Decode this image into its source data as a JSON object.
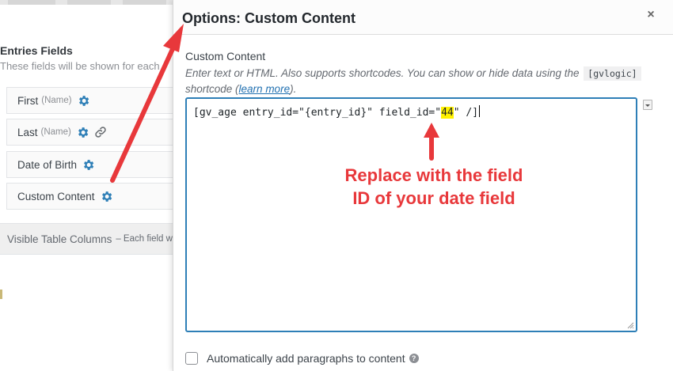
{
  "background": {
    "entries_title": "Entries Fields",
    "entries_desc": "These fields will be shown for each",
    "fields": [
      {
        "name": "First",
        "sub": "(Name)",
        "icons": [
          "gear-icon"
        ]
      },
      {
        "name": "Last",
        "sub": "(Name)",
        "icons": [
          "gear-icon",
          "link-icon"
        ]
      },
      {
        "name": "Date of Birth",
        "sub": "",
        "icons": [
          "gear-icon"
        ]
      },
      {
        "name": "Custom Content",
        "sub": "",
        "icons": [
          "gear-icon"
        ]
      }
    ],
    "visible_columns_label": "Visible Table Columns",
    "visible_columns_note": "– Each field w"
  },
  "modal": {
    "title": "Options: Custom Content",
    "close_symbol": "×",
    "section_label": "Custom Content",
    "help_text_before": "Enter text or HTML. Also supports shortcodes. You can show or hide data using the ",
    "help_code": "[gvlogic]",
    "help_text_mid": " shortcode (",
    "help_link": "learn more",
    "help_text_after": ").",
    "editor": {
      "code_before": "[gv_age entry_id=\"{entry_id}\" field_id=\"",
      "code_highlight": "44",
      "code_after": "\" /]"
    },
    "auto_paragraph_label": "Automatically add paragraphs to content",
    "auto_paragraph_checked": false
  },
  "annotation": {
    "line1": "Replace with the field",
    "line2": "ID of your date field",
    "color": "#e8383b"
  },
  "colors": {
    "gear_blue": "#2e7fb7",
    "editor_border": "#2e7fb7",
    "highlight": "#fff200"
  }
}
